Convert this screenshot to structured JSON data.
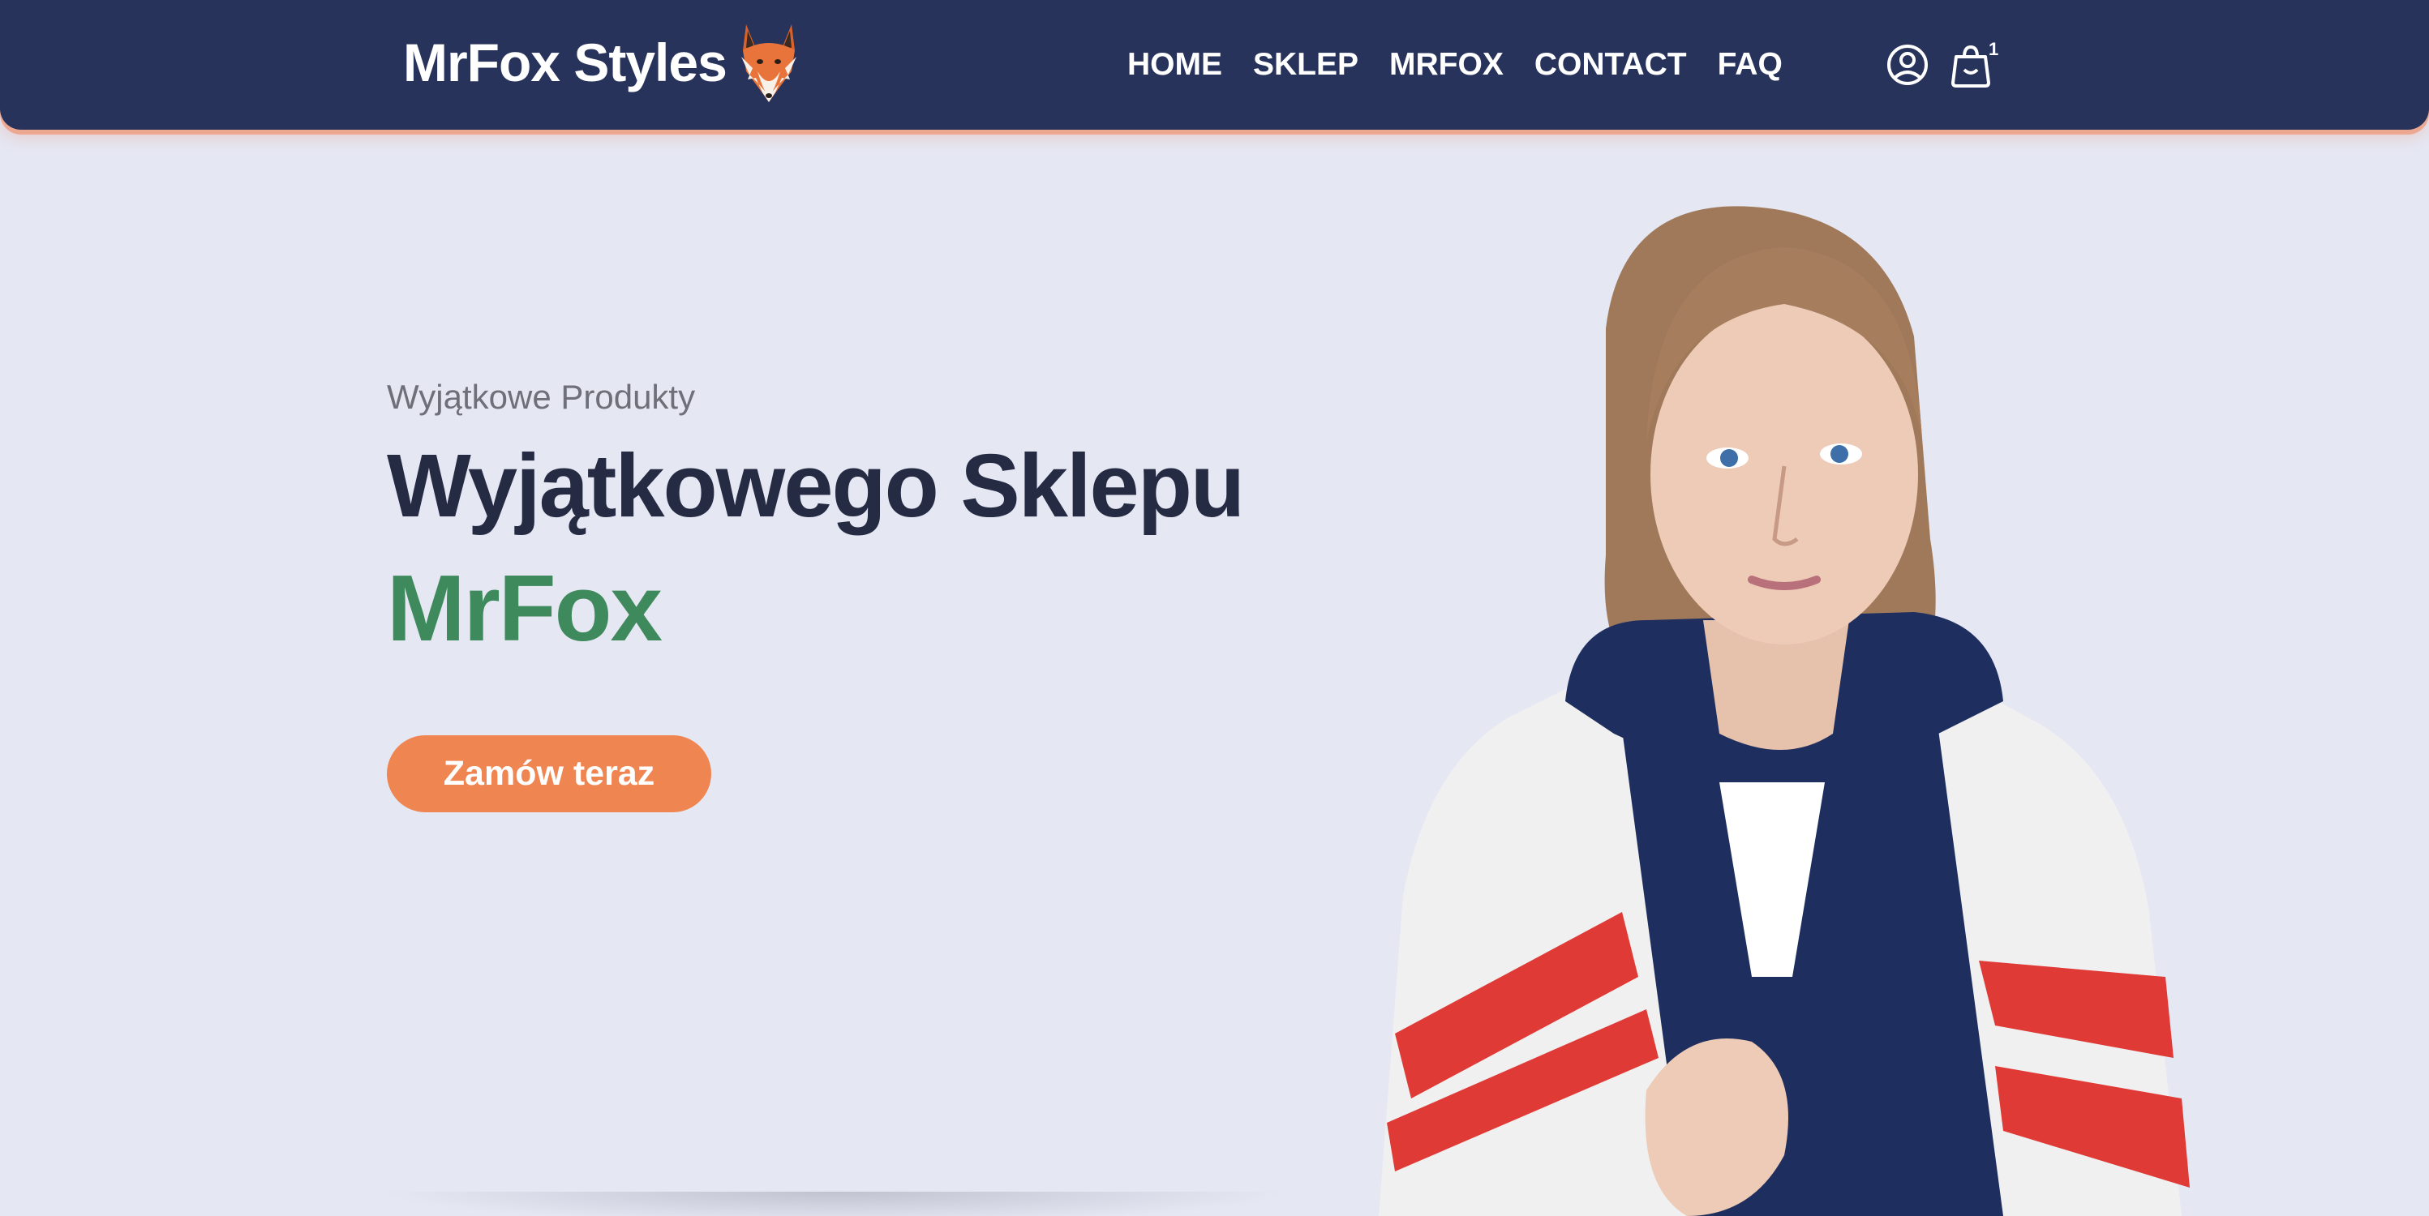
{
  "header": {
    "brand_name": "MrFox Styles",
    "logo_icon": "fox-head-icon",
    "nav": [
      {
        "label": "HOME"
      },
      {
        "label": "SKLEP"
      },
      {
        "label": "MRFOX"
      },
      {
        "label": "CONTACT"
      },
      {
        "label": "FAQ"
      }
    ],
    "user_icon": "user-circle-icon",
    "cart_icon": "shopping-bag-icon",
    "cart_count": "1"
  },
  "hero": {
    "eyebrow": "Wyjątkowe Produkty",
    "title": "Wyjątkowego Sklepu",
    "brand": "MrFox",
    "cta_label": "Zamów teraz",
    "image_icon": "model-in-track-jacket-photo"
  },
  "colors": {
    "header_bg": "#28335b",
    "page_bg": "#e5e7f3",
    "accent_orange": "#ef8551",
    "brand_green": "#3f8a5d",
    "title_dark": "#262b44"
  }
}
